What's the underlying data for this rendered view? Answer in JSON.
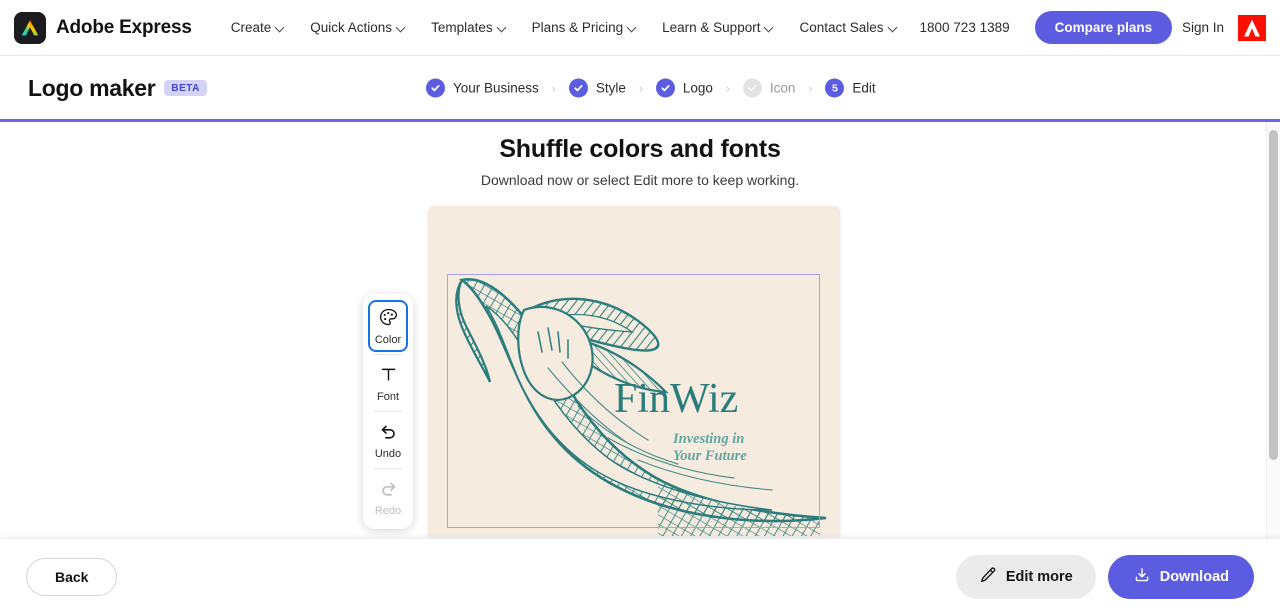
{
  "gnav": {
    "brand_name": "Adobe Express",
    "brand_icon": "adobe-express-logo-icon",
    "menu": [
      {
        "label": "Create",
        "icon": "chevron-down-icon"
      },
      {
        "label": "Quick Actions",
        "icon": "chevron-down-icon"
      },
      {
        "label": "Templates",
        "icon": "chevron-down-icon"
      },
      {
        "label": "Plans & Pricing",
        "icon": "chevron-down-icon"
      },
      {
        "label": "Learn & Support",
        "icon": "chevron-down-icon"
      },
      {
        "label": "Contact Sales",
        "icon": "chevron-down-icon"
      }
    ],
    "phone": "1800 723 1389",
    "compare_plans": "Compare plans",
    "sign_in": "Sign In",
    "adobe_logo_icon": "adobe-a-logo-icon"
  },
  "tool": {
    "title": "Logo maker",
    "badge": "BETA",
    "steps": [
      {
        "label": "Your Business",
        "state": "complete",
        "marker": "check"
      },
      {
        "label": "Style",
        "state": "complete",
        "marker": "check"
      },
      {
        "label": "Logo",
        "state": "complete",
        "marker": "check"
      },
      {
        "label": "Icon",
        "state": "skipped",
        "marker": "check"
      },
      {
        "label": "Edit",
        "state": "current",
        "marker": "5"
      }
    ],
    "separator": "›"
  },
  "main": {
    "heading": "Shuffle colors and fonts",
    "subheading": "Download now or select Edit more to keep working."
  },
  "rail": {
    "buttons": [
      {
        "label": "Color",
        "icon": "palette-icon",
        "state": "active"
      },
      {
        "label": "Font",
        "icon": "text-t-icon",
        "state": "enabled"
      },
      {
        "label": "Undo",
        "icon": "undo-arrow-icon",
        "state": "enabled"
      },
      {
        "label": "Redo",
        "icon": "redo-arrow-icon",
        "state": "disabled"
      }
    ]
  },
  "canvas": {
    "logo_name": "FinWiz",
    "logo_tagline_line1": "Investing in",
    "logo_tagline_line2": "Your Future",
    "artwork_icon": "engraved-leaf-illustration-icon",
    "background_color": "#f6ebdf",
    "art_color": "#2b7d7d",
    "tagline_color": "#62a5a0",
    "selection_color": "#a7a0f0"
  },
  "footer": {
    "back": "Back",
    "edit_more": "Edit more",
    "edit_more_icon": "pencil-icon",
    "download": "Download",
    "download_icon": "download-icon"
  },
  "colors": {
    "accent": "#5c5ce0",
    "progress": "#6767ee",
    "active_outline": "#1473e6",
    "adobe_red": "#fa0f00"
  }
}
